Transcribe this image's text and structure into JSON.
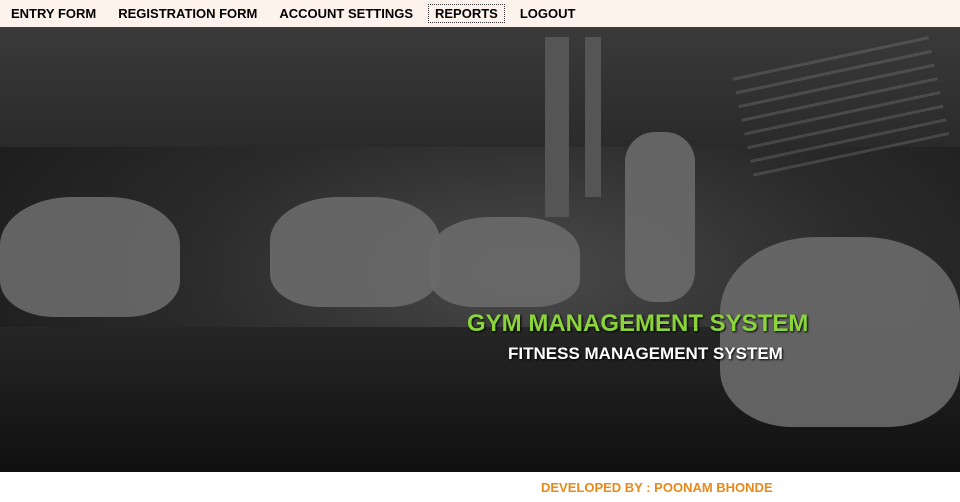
{
  "menu": {
    "items": [
      {
        "label": "ENTRY FORM"
      },
      {
        "label": "REGISTRATION FORM"
      },
      {
        "label": "ACCOUNT SETTINGS"
      },
      {
        "label": "REPORTS"
      },
      {
        "label": "LOGOUT"
      }
    ],
    "active": "REPORTS"
  },
  "hero": {
    "title": "GYM MANAGEMENT SYSTEM",
    "subtitle": "FITNESS MANAGEMENT SYSTEM"
  },
  "footer": {
    "credit": "DEVELOPED BY : POONAM BHONDE"
  },
  "colors": {
    "menubar_bg": "#fdf2ec",
    "title": "#8bd43a",
    "subtitle": "#ffffff",
    "credit": "#e8891c"
  }
}
